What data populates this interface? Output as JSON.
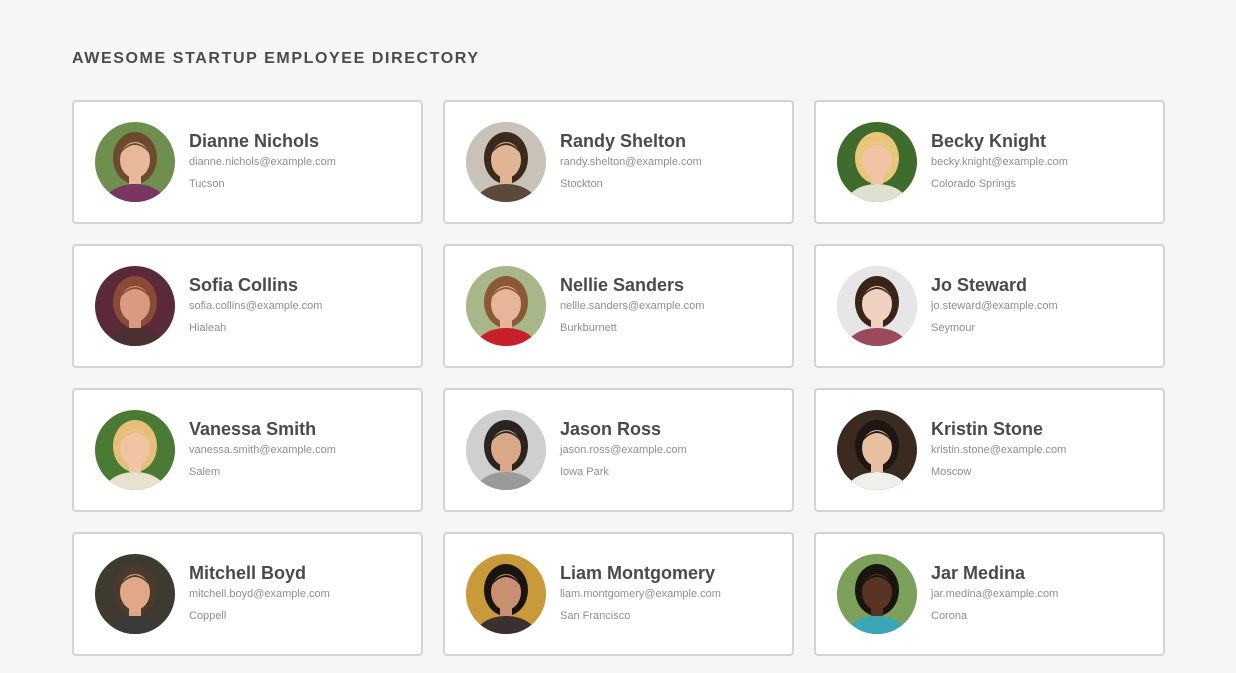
{
  "header": {
    "title": "AWESOME STARTUP EMPLOYEE DIRECTORY"
  },
  "employees": [
    {
      "name": "Dianne Nichols",
      "email": "dianne.nichols@example.com",
      "city": "Tucson",
      "bg": "#6f8f4e",
      "skin": "#e8b89a",
      "hair": "#6b4a2e",
      "shirt": "#7a3560"
    },
    {
      "name": "Randy Shelton",
      "email": "randy.shelton@example.com",
      "city": "Stockton",
      "bg": "#c9c2b8",
      "skin": "#e2b496",
      "hair": "#3a2a1e",
      "shirt": "#5b4a3c"
    },
    {
      "name": "Becky Knight",
      "email": "becky.knight@example.com",
      "city": "Colorado Springs",
      "bg": "#3f6b2c",
      "skin": "#f0c4a4",
      "hair": "#e9c77a",
      "shirt": "#e0e0d0"
    },
    {
      "name": "Sofia Collins",
      "email": "sofia.collins@example.com",
      "city": "Hialeah",
      "bg": "#5a2a3a",
      "skin": "#d99a82",
      "hair": "#8a4a36",
      "shirt": "#4a3030"
    },
    {
      "name": "Nellie Sanders",
      "email": "nellie.sanders@example.com",
      "city": "Burkburnett",
      "bg": "#a8b78a",
      "skin": "#e8b49a",
      "hair": "#8a5a36",
      "shirt": "#c8202a"
    },
    {
      "name": "Jo Steward",
      "email": "jo.steward@example.com",
      "city": "Seymour",
      "bg": "#e6e6e6",
      "skin": "#f0d0c0",
      "hair": "#3a2418",
      "shirt": "#9a4a5a"
    },
    {
      "name": "Vanessa Smith",
      "email": "vanessa.smith@example.com",
      "city": "Salem",
      "bg": "#4a7a34",
      "skin": "#f0c4a4",
      "hair": "#e6c07a",
      "shirt": "#e8e2d0"
    },
    {
      "name": "Jason Ross",
      "email": "jason.ross@example.com",
      "city": "Iowa Park",
      "bg": "#cfcfcf",
      "skin": "#d8a888",
      "hair": "#2a2420",
      "shirt": "#9a9a9a"
    },
    {
      "name": "Kristin Stone",
      "email": "kristin.stone@example.com",
      "city": "Moscow",
      "bg": "#3a2a20",
      "skin": "#e6c0a0",
      "hair": "#1e1612",
      "shirt": "#f0f0ea"
    },
    {
      "name": "Mitchell Boyd",
      "email": "mitchell.boyd@example.com",
      "city": "Coppell",
      "bg": "#3e3a30",
      "skin": "#e0a888",
      "hair": "#4a3a2e",
      "shirt": "#3a3a3a"
    },
    {
      "name": "Liam Montgomery",
      "email": "liam.montgomery@example.com",
      "city": "San Francisco",
      "bg": "#c89a3a",
      "skin": "#c89070",
      "hair": "#1a1410",
      "shirt": "#3a3030"
    },
    {
      "name": "Jar Medina",
      "email": "jar.medina@example.com",
      "city": "Corona",
      "bg": "#7aa05a",
      "skin": "#5a3422",
      "hair": "#1a1410",
      "shirt": "#3aa6b8"
    }
  ]
}
